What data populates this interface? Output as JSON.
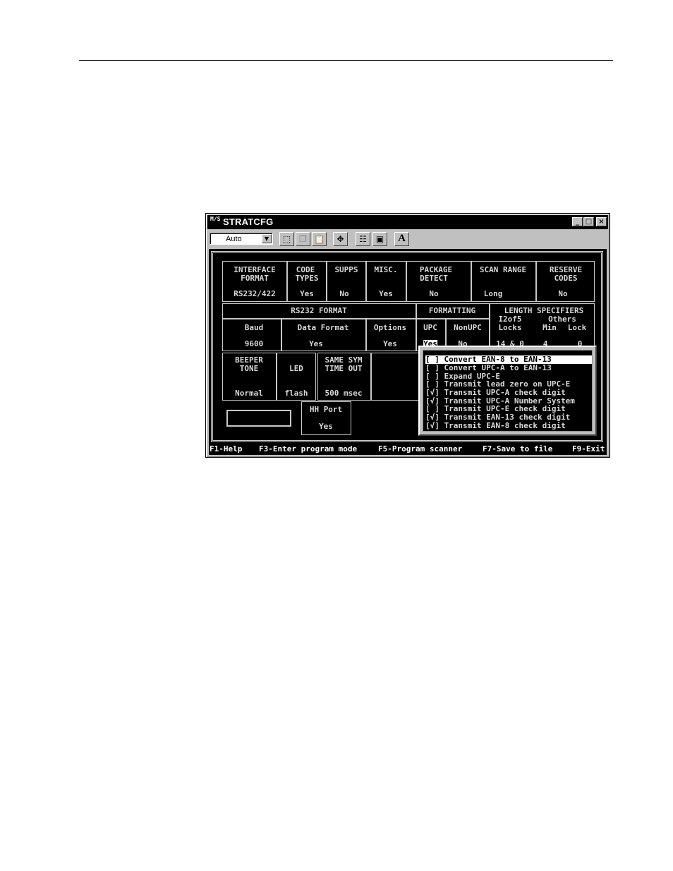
{
  "window": {
    "title": "STRATCFG",
    "icon_text": "M/S",
    "controls": {
      "minimize": "_",
      "maximize": "□",
      "close": "×"
    }
  },
  "toolbar": {
    "combo_value": "Auto",
    "combo_arrow": "▼",
    "buttons": [
      {
        "icon": "select-icon",
        "glyph": "⬚"
      },
      {
        "icon": "copy-icon",
        "glyph": "❐"
      },
      {
        "icon": "paste-icon",
        "glyph": "📋"
      },
      {
        "icon": "fullscreen-icon",
        "glyph": "✥"
      },
      {
        "icon": "properties-icon",
        "glyph": "☷"
      },
      {
        "icon": "background-icon",
        "glyph": "▣"
      },
      {
        "icon": "font-icon",
        "glyph": "A"
      }
    ]
  },
  "grid": {
    "interface_format": {
      "label1": "INTERFACE",
      "label2": "FORMAT",
      "value": "RS232/422"
    },
    "code_types": {
      "label1": "CODE",
      "label2": "TYPES",
      "value": "Yes"
    },
    "supps": {
      "label": "SUPPS",
      "value": "No"
    },
    "misc": {
      "label": "MISC.",
      "value": "Yes"
    },
    "package_detect": {
      "label1": "PACKAGE",
      "label2": "DETECT",
      "value": "No"
    },
    "scan_range": {
      "label": "SCAN RANGE",
      "value": "Long"
    },
    "reserve_codes": {
      "label1": "RESERVE",
      "label2": "CODES",
      "value": "No"
    },
    "rs232_format": {
      "label": "RS232 FORMAT",
      "baud_label": "Baud",
      "baud_value": "9600",
      "data_format_label": "Data Format",
      "data_format_value": "Yes",
      "options_label": "Options",
      "options_value": "Yes"
    },
    "formatting": {
      "label": "FORMATTING",
      "upc_label": "UPC",
      "upc_value": "Yes",
      "nonupc_label": "NonUPC",
      "nonupc_value": "No"
    },
    "length_specifiers": {
      "label": "LENGTH SPECIFIERS",
      "i2of5_label": "I2of5",
      "locks_label": "Locks",
      "locks_value": "14 & 0",
      "others_label": "Others",
      "min_label": "Min",
      "min_value": "4",
      "lock_label": "Lock",
      "lock_value": "0"
    },
    "beeper_tone": {
      "label1": "BEEPER",
      "label2": "TONE",
      "value": "Normal"
    },
    "led": {
      "label": "LED",
      "value": "flash"
    },
    "same_sym": {
      "label1": "SAME SYM",
      "label2": "TIME OUT",
      "value": "500 msec"
    },
    "hh_port": {
      "label": "HH Port",
      "value": "Yes"
    }
  },
  "popup": {
    "options": [
      {
        "check": "[ ]",
        "label": "Convert EAN-8 to EAN-13",
        "selected": true
      },
      {
        "check": "[ ]",
        "label": "Convert UPC-A to EAN-13",
        "selected": false
      },
      {
        "check": "[ ]",
        "label": "Expand UPC-E",
        "selected": false
      },
      {
        "check": "[ ]",
        "label": "Transmit lead zero on UPC-E",
        "selected": false
      },
      {
        "check": "[√]",
        "label": "Transmit UPC-A check digit",
        "selected": false
      },
      {
        "check": "[√]",
        "label": "Transmit UPC-A Number System",
        "selected": false
      },
      {
        "check": "[ ]",
        "label": "Transmit UPC-E check digit",
        "selected": false
      },
      {
        "check": "[√]",
        "label": "Transmit EAN-13 check digit",
        "selected": false
      },
      {
        "check": "[√]",
        "label": "Transmit EAN-8 check digit",
        "selected": false
      }
    ]
  },
  "fkeys": {
    "f1": "F1-Help",
    "f3": "F3-Enter program mode",
    "f5": "F5-Program scanner",
    "f7": "F7-Save to file",
    "f9": "F9-Exit"
  },
  "colors": {
    "titlebar": "#000000",
    "screen_bg": "#000000",
    "screen_text": "#d8d8d8",
    "chrome": "#c0c0c0"
  }
}
